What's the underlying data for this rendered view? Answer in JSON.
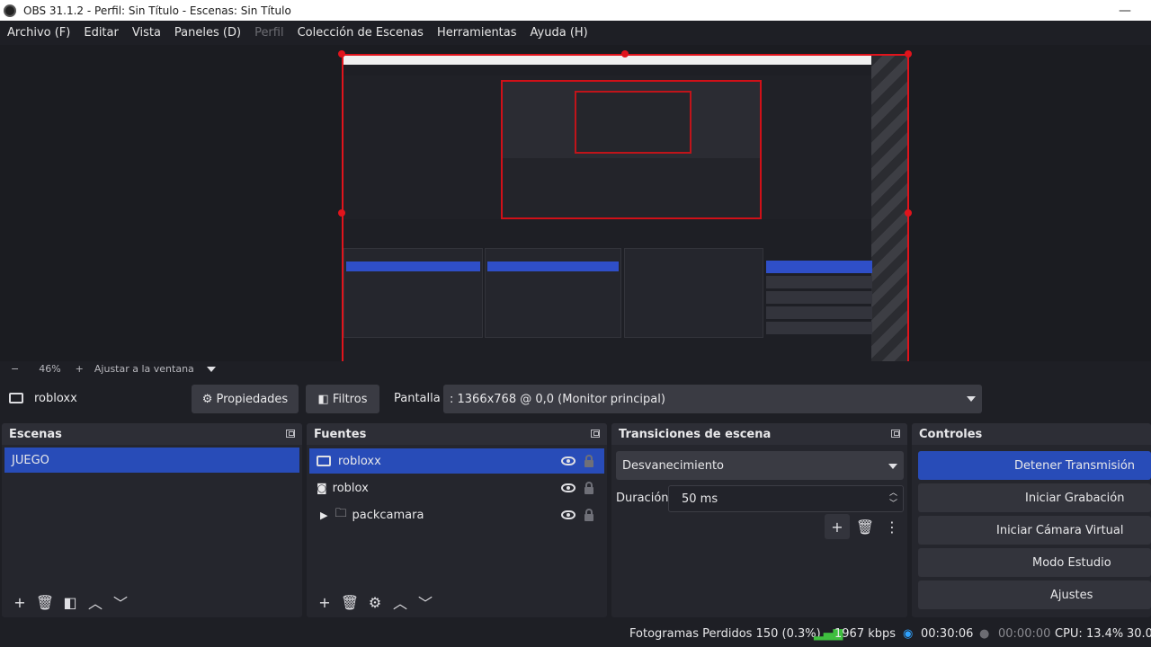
{
  "window": {
    "title": "OBS 31.1.2 - Perfil: Sin Título - Escenas: Sin Título",
    "minimize": "—"
  },
  "menu": [
    "Archivo (F)",
    "Editar",
    "Vista",
    "Paneles (D)",
    "Perfil",
    "Colección de Escenas",
    "Herramientas",
    "Ayuda (H)"
  ],
  "zoom": {
    "minus": "−",
    "value": "46%",
    "plus": "+",
    "fit": "Ajustar a la ventana"
  },
  "source_toolbar": {
    "source_name": "robloxx",
    "properties": "Propiedades",
    "filters": "Filtros",
    "display_label": "Pantalla",
    "display_value": ": 1366x768 @ 0,0 (Monitor principal)"
  },
  "scenes": {
    "title": "Escenas",
    "items": [
      "JUEGO"
    ]
  },
  "sources": {
    "title": "Fuentes",
    "items": [
      {
        "name": "robloxx",
        "icon": "monitor-icon"
      },
      {
        "name": "roblox",
        "icon": "gamepad-icon"
      },
      {
        "name": "packcamara",
        "icon": "folder-icon"
      }
    ]
  },
  "transitions": {
    "title": "Transiciones de escena",
    "selected": "Desvanecimiento",
    "duration_label": "Duración",
    "duration_value": "50 ms"
  },
  "controls": {
    "title": "Controles",
    "buttons": [
      "Detener Transmisión",
      "Iniciar Grabación",
      "Iniciar Cámara Virtual",
      "Modo Estudio",
      "Ajustes"
    ]
  },
  "status": {
    "dropped_frames": "Fotogramas Perdidos 150 (0.3%)",
    "bitrate": "1967 kbps",
    "stream_time": "00:30:06",
    "record_time": "00:00:00",
    "cpu": "CPU: 13.4%",
    "fps": "30.0"
  },
  "colors": {
    "accent": "#284cb8",
    "selection_border": "#e0141c",
    "live": "#2fa2ff",
    "good_signal": "#3fbf3f"
  }
}
